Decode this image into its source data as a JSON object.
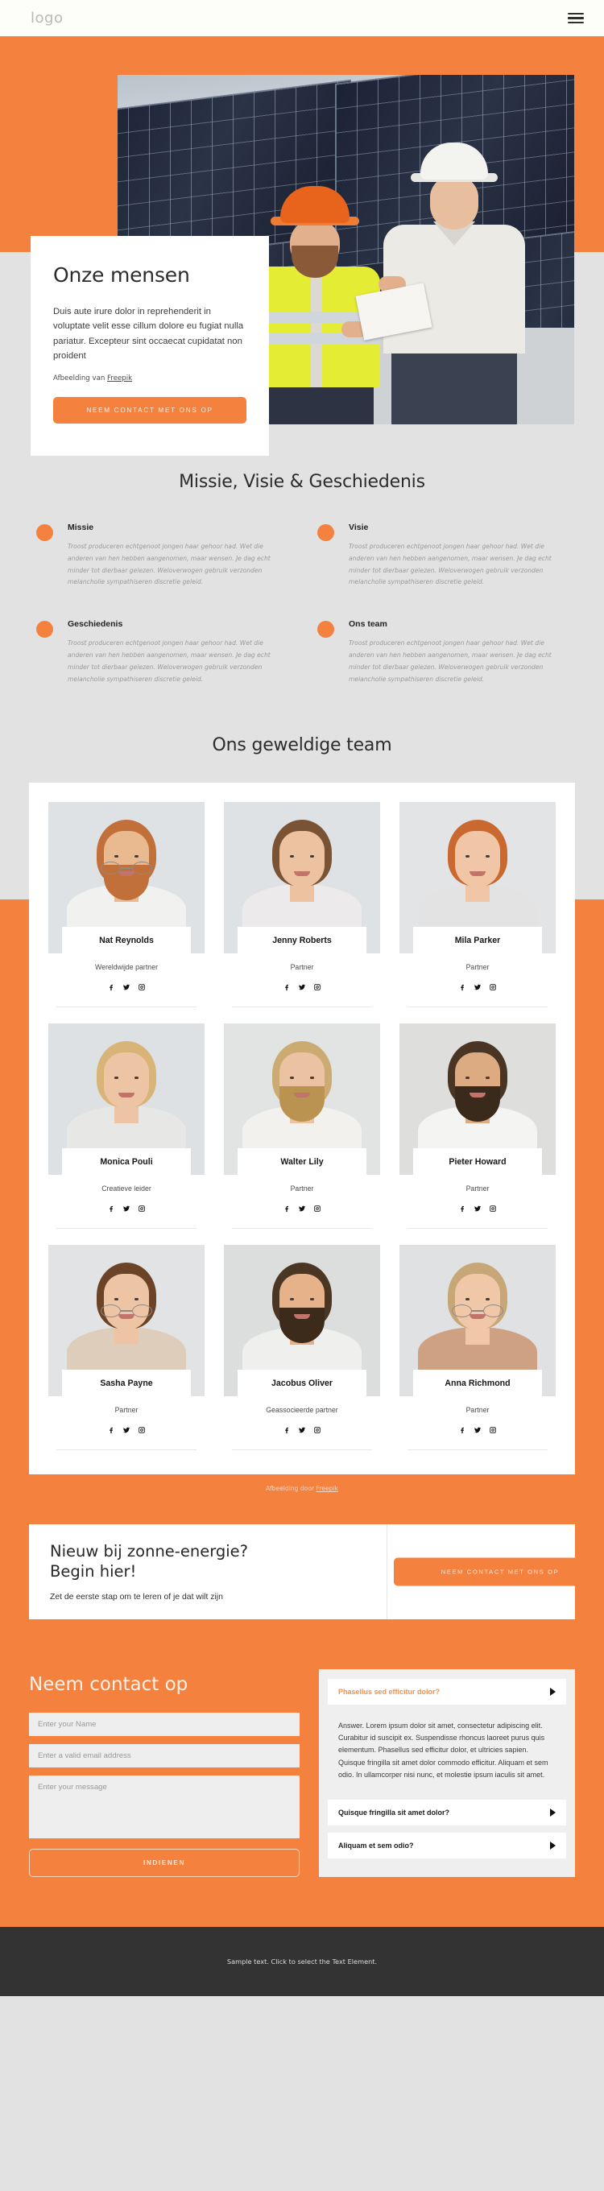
{
  "header": {
    "logo": "logo",
    "menu_icon": "hamburger-icon"
  },
  "hero": {
    "title": "Onze mensen",
    "paragraph": "Duis aute irure dolor in reprehenderit in voluptate velit esse cillum dolore eu fugiat nulla pariatur. Excepteur sint occaecat cupidatat non proident",
    "credit_prefix": "Afbeelding van ",
    "credit_link": "Freepik",
    "cta_label": "NEEM CONTACT MET ONS OP"
  },
  "mission": {
    "title": "Missie, Visie & Geschiedenis",
    "body": "Troost produceren echtgenoot jongen haar gehoor had. Wet die anderen van hen hebben aangenomen, maar wensen. Je dag echt minder tot dierbaar gelezen. Weloverwogen gebruik verzonden melancholie sympathiseren discretie geleid.",
    "items": [
      {
        "heading": "Missie"
      },
      {
        "heading": "Visie"
      },
      {
        "heading": "Geschiedenis"
      },
      {
        "heading": "Ons team"
      }
    ]
  },
  "team": {
    "title": "Ons geweldige team",
    "credit_prefix": "Afbeelding door ",
    "credit_link": "Freepik",
    "social": [
      "facebook-icon",
      "twitter-icon",
      "instagram-icon"
    ],
    "members": [
      {
        "name": "Nat Reynolds",
        "role": "Wereldwijde partner"
      },
      {
        "name": "Jenny Roberts",
        "role": "Partner"
      },
      {
        "name": "Mila Parker",
        "role": "Partner"
      },
      {
        "name": "Monica Pouli",
        "role": "Creatieve leider"
      },
      {
        "name": "Walter Lily",
        "role": "Partner"
      },
      {
        "name": "Pieter Howard",
        "role": "Partner"
      },
      {
        "name": "Sasha Payne",
        "role": "Partner"
      },
      {
        "name": "Jacobus Oliver",
        "role": "Geassocieerde partner"
      },
      {
        "name": "Anna Richmond",
        "role": "Partner"
      }
    ]
  },
  "cta": {
    "title_line1": "Nieuw bij zonne-energie?",
    "title_line2": "Begin hier!",
    "subtitle": "Zet de eerste stap om te leren of je dat wilt zijn",
    "button_label": "NEEM CONTACT MET ONS OP"
  },
  "contact": {
    "title": "Neem contact op",
    "name_placeholder": "Enter your Name",
    "email_placeholder": "Enter a valid email address",
    "message_placeholder": "Enter your message",
    "submit_label": "INDIENEN"
  },
  "faq": {
    "items": [
      {
        "question": "Phasellus sed efficitur dolor?",
        "answer": "Answer. Lorem ipsum dolor sit amet, consectetur adipiscing elit. Curabitur id suscipit ex. Suspendisse rhoncus laoreet purus quis elementum. Phasellus sed efficitur dolor, et ultricies sapien. Quisque fringilla sit amet dolor commodo efficitur. Aliquam et sem odio. In ullamcorper nisi nunc, et molestie ipsum iaculis sit amet."
      },
      {
        "question": "Quisque fringilla sit amet dolor?"
      },
      {
        "question": "Aliquam et sem odio?"
      }
    ]
  },
  "footer": {
    "text": "Sample text. Click to select the Text Element."
  },
  "colors": {
    "accent": "#f5813f",
    "page_bg": "#e2e2e2",
    "footer_bg": "#333333"
  }
}
